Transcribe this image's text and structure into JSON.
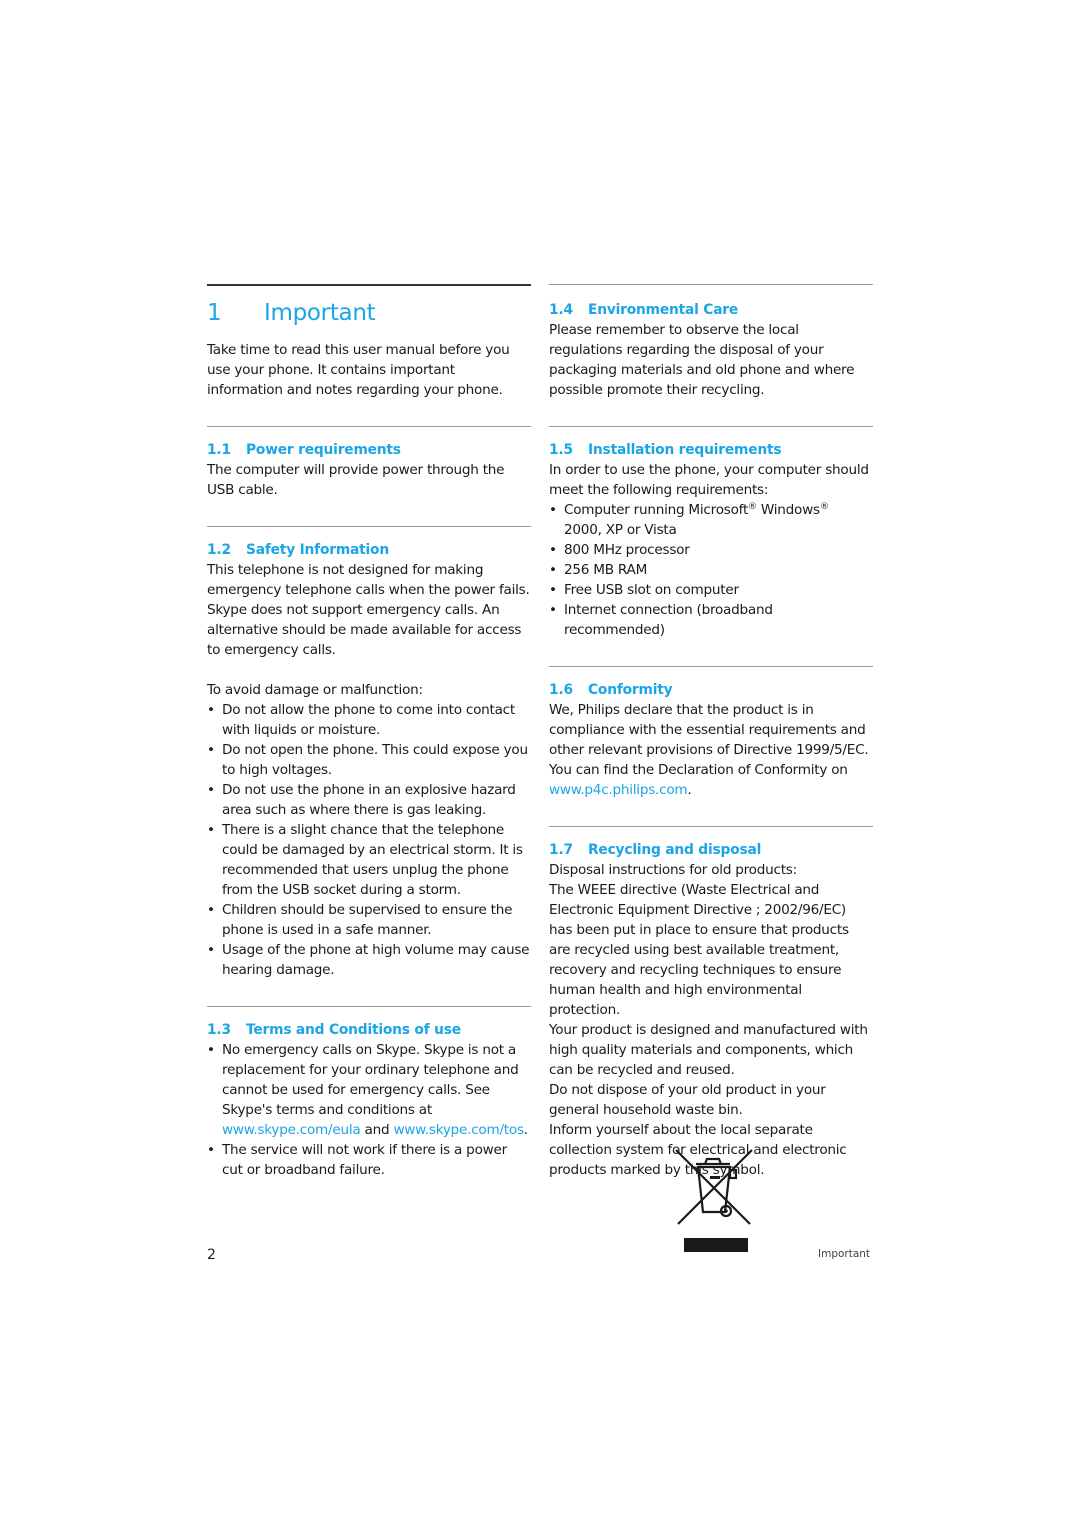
{
  "chapter": {
    "number": "1",
    "title": "Important"
  },
  "intro": "Take time to read this user manual before you use your phone. It contains important information and notes regarding your phone.",
  "colors": {
    "accent": "#1aa5e6",
    "text": "#1a1a1a",
    "rule": "#9a9a9a"
  },
  "sections": {
    "s1_1": {
      "number": "1.1",
      "title": "Power requirements",
      "body": "The computer will provide power through the USB cable."
    },
    "s1_2": {
      "number": "1.2",
      "title": "Safety Information",
      "body": "This telephone is not designed for making emergency telephone calls when the power fails. Skype does not support emergency calls. An alternative should be made available for access to emergency calls.",
      "lead": "To avoid damage or malfunction:",
      "bullets": [
        "Do not allow the phone to come into contact with liquids or moisture.",
        "Do not open the phone. This could expose you to high voltages.",
        "Do not use the phone in an explosive hazard area such as where there is gas leaking.",
        "There is a slight chance that the telephone could be damaged by an electrical storm. It is recommended that users unplug the phone from the USB socket during a storm.",
        "Children should be supervised to ensure the phone is used in a safe manner.",
        "Usage of the phone at high volume may cause hearing damage."
      ]
    },
    "s1_3": {
      "number": "1.3",
      "title": "Terms and Conditions of use",
      "bullet1_text": "No emergency calls on Skype. Skype is not a replacement for your ordinary telephone and cannot be used for emergency calls. See Skype's terms and conditions at",
      "link_eula": "www.skype.com/eula",
      "and": "and",
      "link_tos": "www.skype.com/tos",
      "period": ".",
      "bullet2": "The service will not work if there is a power cut or broadband failure."
    },
    "s1_4": {
      "number": "1.4",
      "title": "Environmental Care",
      "body": "Please remember to observe the local regulations regarding the disposal of your packaging materials and old phone and where possible promote their recycling."
    },
    "s1_5": {
      "number": "1.5",
      "title": "Installation requirements",
      "body": "In order to use the phone, your computer should meet the following requirements:",
      "bullet1_a": "Computer running Microsoft",
      "reg": "®",
      "bullet1_b": " Windows",
      "bullet1_c": "2000, XP or Vista",
      "bullets": [
        "800 MHz processor",
        "256 MB RAM",
        "Free USB slot on computer",
        "Internet connection (broadband recommended)"
      ]
    },
    "s1_6": {
      "number": "1.6",
      "title": "Conformity",
      "body": "We, Philips declare that the product is in compliance with the essential requirements and other relevant provisions of Directive 1999/5/EC. You can find the Declaration of Conformity on",
      "link": "www.p4c.philips.com",
      "period": "."
    },
    "s1_7": {
      "number": "1.7",
      "title": "Recycling and disposal",
      "paragraphs": [
        "Disposal instructions for old products:",
        "The WEEE directive (Waste Electrical and Electronic Equipment Directive ; 2002/96/EC) has been put in place to ensure that products are recycled using best available treatment, recovery and recycling techniques to ensure human health and high environmental protection.",
        "Your product is designed and manufactured with high quality materials and components, which can be recycled and reused.",
        "Do not dispose of your old product in your general household waste bin.",
        "Inform yourself about the local separate collection system for electrical and electronic products marked by this symbol."
      ],
      "symbol_icon": "weee-crossed-bin-icon"
    }
  },
  "footer": {
    "page_number": "2",
    "section_label": "Important"
  },
  "bullet_char": "•"
}
